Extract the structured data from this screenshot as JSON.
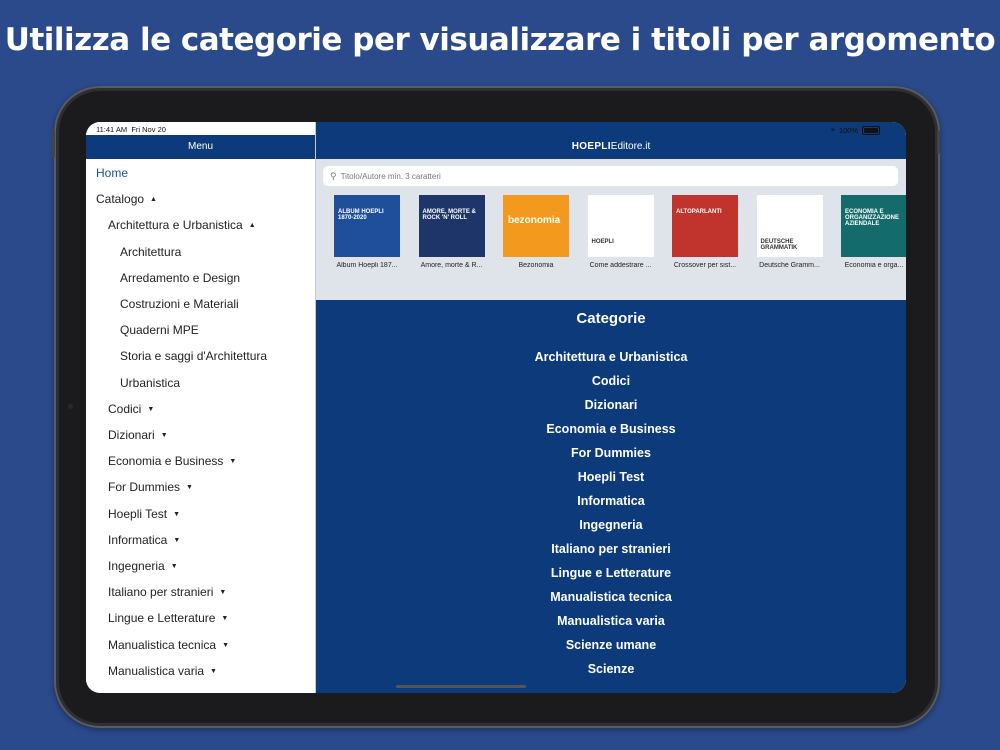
{
  "headline": "Utilizza le categorie per visualizzare i titoli per argomento",
  "status": {
    "time": "11:41 AM",
    "date": "Fri Nov 20",
    "battery": "100%"
  },
  "sidebar": {
    "title": "Menu",
    "items": [
      {
        "label": "Home",
        "caret": ""
      },
      {
        "label": "Catalogo",
        "caret": "▲"
      },
      {
        "label": "Architettura e Urbanistica",
        "caret": "▲"
      },
      {
        "label": "Architettura",
        "caret": ""
      },
      {
        "label": "Arredamento e Design",
        "caret": ""
      },
      {
        "label": "Costruzioni e Materiali",
        "caret": ""
      },
      {
        "label": "Quaderni MPE",
        "caret": ""
      },
      {
        "label": "Storia e saggi d'Architettura",
        "caret": ""
      },
      {
        "label": "Urbanistica",
        "caret": ""
      },
      {
        "label": "Codici",
        "caret": "▼"
      },
      {
        "label": "Dizionari",
        "caret": "▼"
      },
      {
        "label": "Economia e Business",
        "caret": "▼"
      },
      {
        "label": "For Dummies",
        "caret": "▼"
      },
      {
        "label": "Hoepli Test",
        "caret": "▼"
      },
      {
        "label": "Informatica",
        "caret": "▼"
      },
      {
        "label": "Ingegneria",
        "caret": "▼"
      },
      {
        "label": "Italiano per stranieri",
        "caret": "▼"
      },
      {
        "label": "Lingue e Letterature",
        "caret": "▼"
      },
      {
        "label": "Manualistica tecnica",
        "caret": "▼"
      },
      {
        "label": "Manualistica varia",
        "caret": "▼"
      }
    ]
  },
  "header": {
    "brand_bold": "HOEPLI",
    "brand_light": "Editore.it"
  },
  "search": {
    "placeholder": "Titolo/Autore min. 3 caratteri"
  },
  "books": [
    {
      "label": "Album Hoepli 187...",
      "cover_text": "ALBUM HOEPLI 1870-2020",
      "color": "#1f4e9a"
    },
    {
      "label": "Amore, morte & R...",
      "cover_text": "AMORE, MORTE & ROCK 'N' ROLL",
      "color": "#1d3568"
    },
    {
      "label": "Bezonomia",
      "cover_text": "bezonomia",
      "color": "#f39a1e"
    },
    {
      "label": "Come addestrare ...",
      "cover_text": "HOEPLI",
      "color": "#ffffff"
    },
    {
      "label": "Crossover per sist...",
      "cover_text": "ALTOPARLANTI",
      "color": "#c0342d"
    },
    {
      "label": "Deutsche Gramm...",
      "cover_text": "DEUTSCHE GRAMMATIK",
      "color": "#ffffff"
    },
    {
      "label": "Economia e orga...",
      "cover_text": "ECONOMIA E ORGANIZZAZIONE AZIENDALE",
      "color": "#146b6b"
    }
  ],
  "categories": {
    "title": "Categorie",
    "items": [
      "Architettura e Urbanistica",
      "Codici",
      "Dizionari",
      "Economia e Business",
      "For Dummies",
      "Hoepli Test",
      "Informatica",
      "Ingegneria",
      "Italiano per stranieri",
      "Lingue e Letterature",
      "Manualistica tecnica",
      "Manualistica varia",
      "Scienze umane",
      "Scienze"
    ]
  }
}
